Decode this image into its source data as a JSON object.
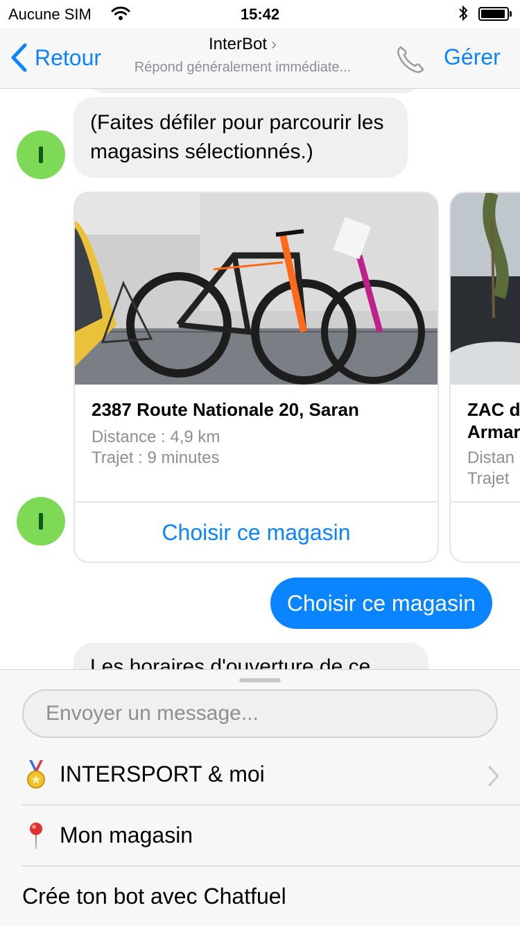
{
  "status": {
    "carrier": "Aucune SIM",
    "time": "15:42"
  },
  "nav": {
    "back_label": "Retour",
    "title": "InterBot",
    "subtitle": "Répond généralement immédiate...",
    "manage_label": "Gérer"
  },
  "conversation": {
    "bot_message_1": "(Faites défiler pour parcourir les magasins sélectionnés.)",
    "avatar_letter": "I",
    "cards": [
      {
        "title": "2387 Route Nationale 20, Saran",
        "distance": "Distance : 4,9 km",
        "travel": "Trajet : 9 minutes",
        "button": "Choisir ce magasin"
      },
      {
        "title": "ZAC d\nArmar",
        "distance": "Distan",
        "travel": "Trajet"
      }
    ],
    "user_message": "Choisir ce magasin",
    "bot_message_2": "Les horaires d'ouverture de ce"
  },
  "composer": {
    "placeholder": "Envoyer un message...",
    "menu": [
      {
        "label": "INTERSPORT & moi",
        "icon": "medal-icon"
      },
      {
        "label": "Mon magasin",
        "icon": "pin-icon"
      },
      {
        "label": "Crée ton bot avec Chatfuel"
      }
    ]
  },
  "colors": {
    "accent": "#0a84ff",
    "avatar": "#7ed957",
    "bubble_gray": "#f0f0f0"
  }
}
